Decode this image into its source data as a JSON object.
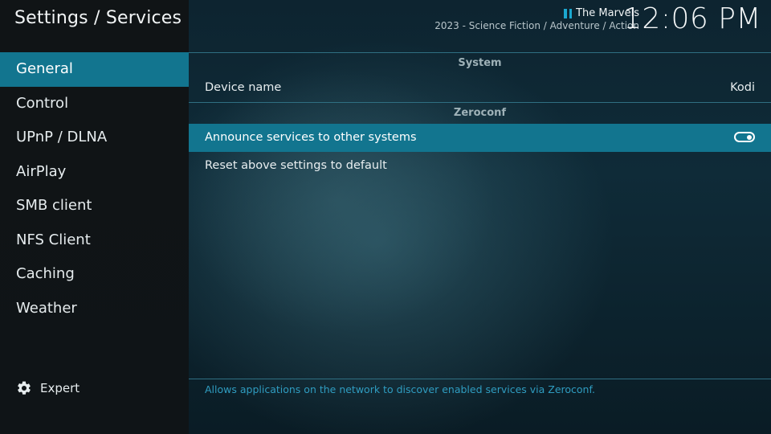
{
  "header": {
    "title": "Settings / Services",
    "now_playing": {
      "title": "The Marvels",
      "subtitle": "2023 - Science Fiction / Adventure / Action",
      "state_icon": "pause-icon"
    },
    "clock": "12:06 PM"
  },
  "sidebar": {
    "items": [
      {
        "label": "General",
        "active": true
      },
      {
        "label": "Control"
      },
      {
        "label": "UPnP / DLNA"
      },
      {
        "label": "AirPlay"
      },
      {
        "label": "SMB client"
      },
      {
        "label": "NFS Client"
      },
      {
        "label": "Caching"
      },
      {
        "label": "Weather"
      }
    ],
    "expert": {
      "label": "Expert",
      "icon": "gear-icon"
    }
  },
  "content": {
    "sections": [
      {
        "header": "System",
        "rows": [
          {
            "label": "Device name",
            "value": "Kodi"
          }
        ]
      },
      {
        "header": "Zeroconf",
        "rows": [
          {
            "label": "Announce services to other systems",
            "toggle": true,
            "selected": true
          },
          {
            "label": "Reset above settings to default"
          }
        ]
      }
    ],
    "help": "Allows applications on the network to discover enabled services via Zeroconf."
  },
  "colors": {
    "accent": "#12758f",
    "help_text": "#2f9cc0",
    "separator": "#2f6f82"
  }
}
